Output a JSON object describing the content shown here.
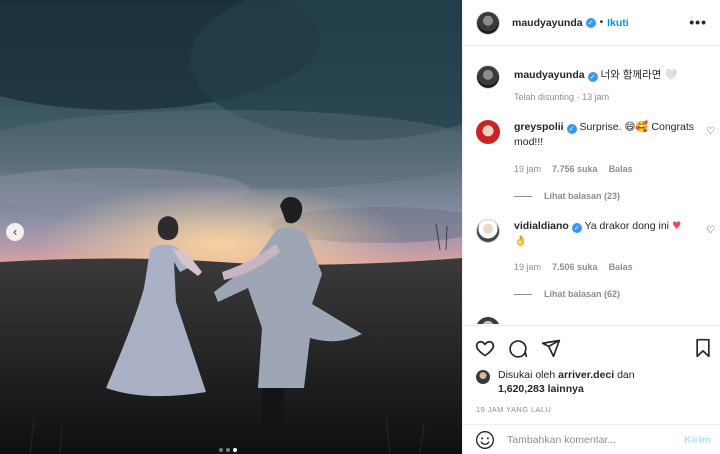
{
  "photo": {
    "description_icon": "photo",
    "carousel": {
      "prev_icon": "chevron-left-icon",
      "dots": 3,
      "active_index": 2
    }
  },
  "header": {
    "username": "maudyayunda",
    "separator": "•",
    "follow_label": "Ikuti",
    "more_label": "•••"
  },
  "caption": {
    "username": "maudyayunda",
    "text": "너와 함께라면 🤍",
    "edited": "Telah disunting",
    "dot": "·",
    "time": "13 jam"
  },
  "comments": [
    {
      "username": "greyspolii",
      "text": "Surprise. 😄🥰 Congrats mod!!!",
      "time": "19 jam",
      "likes": "7.756 suka",
      "reply_label": "Balas",
      "view_replies": "Lihat balasan (23)"
    },
    {
      "username": "vidialdiano",
      "text": "Ya drakor dong ini",
      "text_emoji_tail": "♥",
      "text_second": "👌",
      "time": "19 jam",
      "likes": "7.506 suka",
      "reply_label": "Balas",
      "view_replies": "Lihat balasan (62)"
    }
  ],
  "likes": {
    "prefix": "Disukai oleh",
    "user": "arriver.deci",
    "mid": "dan",
    "count": "1,620,283 lainnya"
  },
  "time_ago": "19 JAM YANG LALU",
  "comment_box": {
    "placeholder": "Tambahkan komentar...",
    "post_label": "Kirim"
  },
  "colors": {
    "link": "#0095f6",
    "muted": "#8e8e8e",
    "verified": "#3897f0",
    "post_disabled": "#b2dffc"
  }
}
